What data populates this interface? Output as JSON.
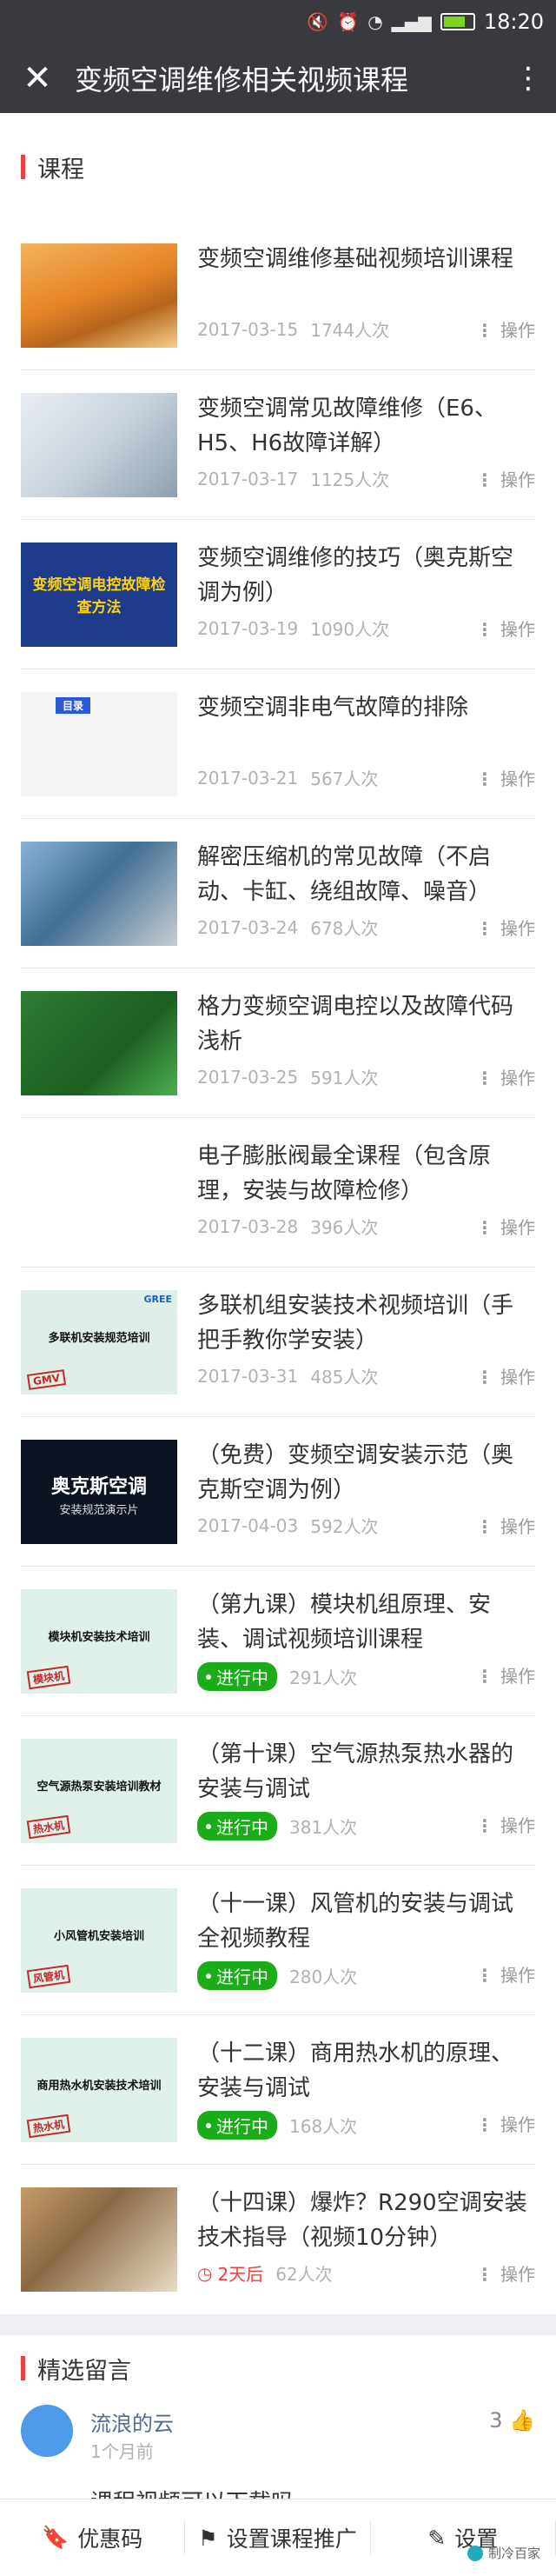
{
  "status": {
    "time": "18:20"
  },
  "nav": {
    "title": "变频空调维修相关视频课程"
  },
  "courses_section": {
    "title": "课程"
  },
  "op_label": "操作",
  "courses": [
    {
      "title": "变频空调维修基础视频培训课程",
      "date": "2017-03-15",
      "views": "1744人次"
    },
    {
      "title": "变频空调常见故障维修（E6、H5、H6故障详解）",
      "date": "2017-03-17",
      "views": "1125人次"
    },
    {
      "title": "变频空调维修的技巧（奥克斯空调为例）",
      "date": "2017-03-19",
      "views": "1090人次",
      "thumb_text": "变频空调电控故障检查方法"
    },
    {
      "title": "变频空调非电气故障的排除",
      "date": "2017-03-21",
      "views": "567人次",
      "thumb_text": "目录"
    },
    {
      "title": "解密压缩机的常见故障（不启动、卡缸、绕组故障、噪音）",
      "date": "2017-03-24",
      "views": "678人次"
    },
    {
      "title": "格力变频空调电控以及故障代码浅析",
      "date": "2017-03-25",
      "views": "591人次"
    },
    {
      "title": "电子膨胀阀最全课程（包含原理，安装与故障检修）",
      "date": "2017-03-28",
      "views": "396人次"
    },
    {
      "title": "多联机组安装技术视频培训（手把手教你学安装）",
      "date": "2017-03-31",
      "views": "485人次",
      "thumb_text": "多联机安装规范培训",
      "thumb_brand": "GREE",
      "thumb_stamp": "GMV"
    },
    {
      "title": "（免费）变频空调安装示范（奥克斯空调为例）",
      "date": "2017-04-03",
      "views": "592人次",
      "thumb_text": "奥克斯空调",
      "thumb_sub": "安装规范演示片"
    },
    {
      "title": "（第九课）模块机组原理、安装、调试视频培训课程",
      "status": "进行中",
      "views": "291人次",
      "thumb_text": "模块机安装技术培训",
      "thumb_stamp": "模块机"
    },
    {
      "title": "（第十课）空气源热泵热水器的安装与调试",
      "status": "进行中",
      "views": "381人次",
      "thumb_text": "空气源热泵安装培训教材",
      "thumb_stamp": "热水机"
    },
    {
      "title": "（十一课）风管机的安装与调试全视频教程",
      "status": "进行中",
      "views": "280人次",
      "thumb_text": "小风管机安装培训",
      "thumb_stamp": "风管机"
    },
    {
      "title": "（十二课）商用热水机的原理、安装与调试",
      "status": "进行中",
      "views": "168人次",
      "thumb_text": "商用热水机安装技术培训",
      "thumb_stamp": "热水机"
    },
    {
      "title": "（十四课）爆炸？R290空调安装技术指导（视频10分钟）",
      "days": "2天后",
      "views": "62人次"
    }
  ],
  "comments_section": {
    "title": "精选留言"
  },
  "comment": {
    "name": "流浪的云",
    "time": "1个月前",
    "likes": "3",
    "text": "课程视频可以下载吗"
  },
  "toolbar": {
    "coupon": "优惠码",
    "promote": "设置课程推广",
    "settings": "设置"
  },
  "watermark": "制冷百家"
}
